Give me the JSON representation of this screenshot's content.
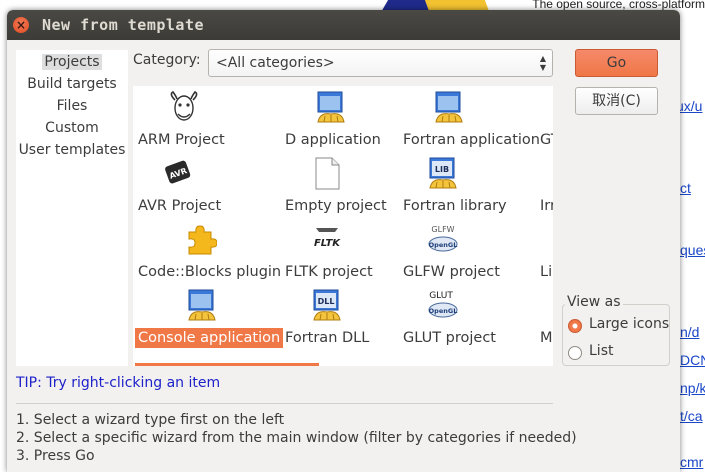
{
  "background": {
    "header_text": "The open source, cross-platform",
    "links": [
      "ux/u",
      "ct",
      "ques",
      "n/d",
      "DCN",
      "np/k",
      "t/ca",
      "cmr"
    ]
  },
  "dialog": {
    "title": "New from template",
    "close_glyph": "×"
  },
  "left_list": {
    "items": [
      "Projects",
      "Build targets",
      "Files",
      "Custom",
      "User templates"
    ],
    "selected": "Projects"
  },
  "category": {
    "label": "Category:",
    "value": "<All categories>"
  },
  "wizards": [
    {
      "label": "ARM Project",
      "icon": "gnu-icon"
    },
    {
      "label": "D application",
      "icon": "window-shell-icon"
    },
    {
      "label": "Fortran application",
      "icon": "window-shell-icon"
    },
    {
      "label": "GTI",
      "icon": ""
    },
    {
      "label": "AVR Project",
      "icon": "avr-chip-icon"
    },
    {
      "label": "Empty project",
      "icon": "blank-page-icon"
    },
    {
      "label": "Fortran library",
      "icon": "lib-shell-icon"
    },
    {
      "label": "Irrl",
      "icon": ""
    },
    {
      "label": "Code::Blocks plugin",
      "icon": "puzzle-icon"
    },
    {
      "label": "FLTK project",
      "icon": "fltk-icon"
    },
    {
      "label": "GLFW project",
      "icon": "glfw-opengl-icon"
    },
    {
      "label": "Lig",
      "icon": ""
    },
    {
      "label": "Console application",
      "icon": "window-shell-icon"
    },
    {
      "label": "Fortran DLL",
      "icon": "dll-shell-icon"
    },
    {
      "label": "GLUT project",
      "icon": "glut-opengl-icon"
    },
    {
      "label": "MC",
      "icon": ""
    }
  ],
  "selected_wizard": "Console application",
  "icon_texts": {
    "avr": "AVR",
    "fltk": "FLTK",
    "lib": "LIB",
    "dll": "DLL",
    "glfw": "GLFW",
    "glut": "GLUT",
    "opengl": "OpenGL"
  },
  "buttons": {
    "go": "Go",
    "cancel": "取消(C)"
  },
  "view_as": {
    "title": "View as",
    "options": [
      "Large icons",
      "List"
    ],
    "selected": "Large icons"
  },
  "tip": "TIP: Try right-clicking an item",
  "steps": [
    "1. Select a wizard type first on the left",
    "2. Select a specific wizard from the main window (filter by categories if needed)",
    "3. Press Go"
  ],
  "colors": {
    "accent": "#f07746",
    "titlebar": "#3c3b37",
    "tip": "#1e22c8",
    "link": "#1a46c8"
  }
}
